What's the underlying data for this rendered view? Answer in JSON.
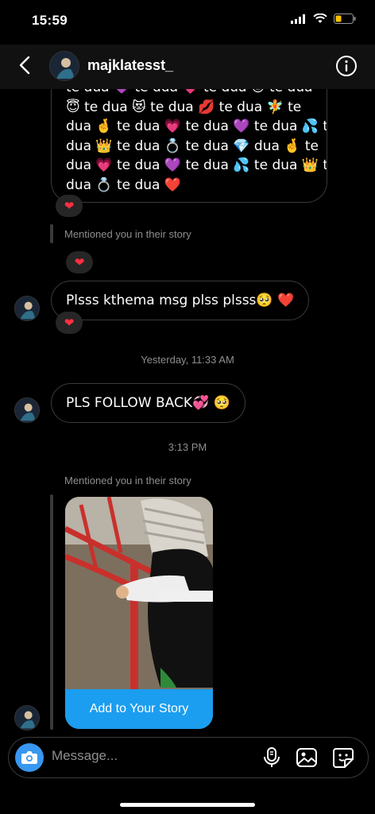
{
  "status": {
    "time": "15:59"
  },
  "header": {
    "username": "majklatesst_",
    "back_icon": "chevron-left-icon",
    "info_icon": "info-icon"
  },
  "messages": {
    "top_emoji_lines": [
      "te dua 💜 te dua 💗 te dua 😻 te dua",
      "😇 te dua 😻 te dua 💋 te dua 🧚 te",
      "dua 🤞 te dua 💗 te dua 💜 te dua 💦 te",
      "dua 👑 te dua 💍 te dua 💎 dua 🤞 te",
      "dua 💗 te dua 💜 te dua 💦 te dua 👑 te",
      "dua 💍 te dua ❤️"
    ],
    "reaction": "❤",
    "mention1": "Mentioned you in their story",
    "msg_plsss": "Plsss kthema msg plss plsss🥺 ❤️",
    "timestamp1": "Yesterday, 11:33 AM",
    "msg_follow": "PLS FOLLOW BACK💞 🥺",
    "timestamp2": "3:13 PM",
    "mention2": "Mentioned you in their story",
    "story_button": "Add to Your Story"
  },
  "composer": {
    "placeholder": "Message..."
  },
  "colors": {
    "accent": "#3897f0",
    "story_button": "#1b9df0",
    "heart": "#ff3040",
    "bubble_border": "#3a3a3a"
  }
}
